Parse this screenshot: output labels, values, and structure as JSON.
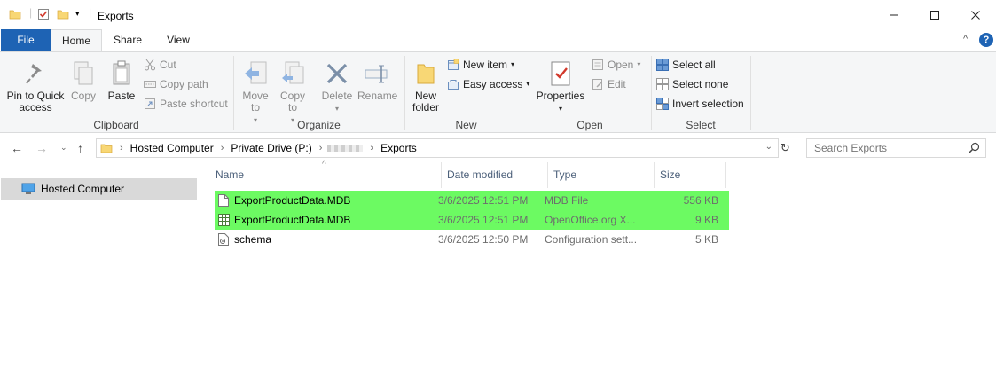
{
  "window": {
    "title": "Exports"
  },
  "tabs": {
    "file": "File",
    "home": "Home",
    "share": "Share",
    "view": "View"
  },
  "ribbon": {
    "clipboard": {
      "label": "Clipboard",
      "pin": "Pin to Quick access",
      "copy": "Copy",
      "paste": "Paste",
      "cut": "Cut",
      "copy_path": "Copy path",
      "paste_shortcut": "Paste shortcut"
    },
    "organize": {
      "label": "Organize",
      "move_to": "Move to",
      "copy_to": "Copy to",
      "delete": "Delete",
      "rename": "Rename"
    },
    "new": {
      "label": "New",
      "new_folder": "New folder",
      "new_item": "New item",
      "easy_access": "Easy access"
    },
    "open": {
      "label": "Open",
      "properties": "Properties",
      "open": "Open",
      "edit": "Edit"
    },
    "select": {
      "label": "Select",
      "select_all": "Select all",
      "select_none": "Select none",
      "invert_selection": "Invert selection"
    }
  },
  "address": {
    "crumbs": [
      "Hosted Computer",
      "Private Drive (P:)",
      "Exports"
    ],
    "search_placeholder": "Search Exports"
  },
  "navpane": {
    "items": [
      {
        "label": "Hosted Computer"
      }
    ]
  },
  "columns": {
    "name": "Name",
    "date": "Date modified",
    "type": "Type",
    "size": "Size"
  },
  "files": [
    {
      "name": "ExportProductData.MDB",
      "date": "3/6/2025 12:51 PM",
      "type": "MDB File",
      "size": "556 KB",
      "icon": "document-icon"
    },
    {
      "name": "ExportProductData.MDB",
      "date": "3/6/2025 12:51 PM",
      "type": "OpenOffice.org X...",
      "size": "9 KB",
      "icon": "spreadsheet-icon"
    },
    {
      "name": "schema",
      "date": "3/6/2025 12:50 PM",
      "type": "Configuration sett...",
      "size": "5 KB",
      "icon": "config-file-icon"
    }
  ],
  "colors": {
    "file_tab": "#1e63b4",
    "highlight": "#6cfa62",
    "folder": "#f8d775",
    "accent": "#1e63b4"
  }
}
